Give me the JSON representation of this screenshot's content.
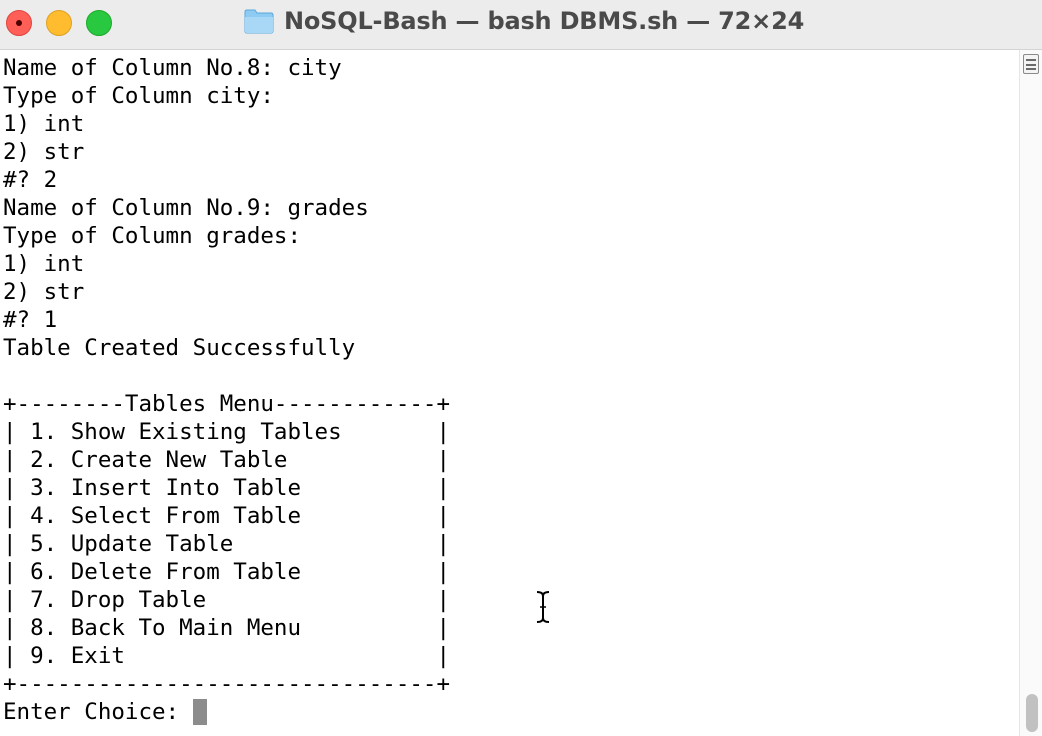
{
  "window": {
    "title": "NoSQL-Bash — bash DBMS.sh — 72×24"
  },
  "icons": {
    "folder": "folder-icon",
    "cursor": "ibeam-cursor-icon",
    "scroll_toggle": "split-pane-icon"
  },
  "colors": {
    "close": "#ff5f57",
    "minimize": "#febc2e",
    "maximize": "#28c840",
    "text": "#000000",
    "cursor": "#8c8c8c"
  },
  "terminal": {
    "lines": [
      "Name of Column No.8: city",
      "Type of Column city:",
      "1) int",
      "2) str",
      "#? 2",
      "Name of Column No.9: grades",
      "Type of Column grades:",
      "1) int",
      "2) str",
      "#? 1",
      "Table Created Successfully",
      "",
      "+--------Tables Menu------------+",
      "| 1. Show Existing Tables       |",
      "| 2. Create New Table           |",
      "| 3. Insert Into Table          |",
      "| 4. Select From Table          |",
      "| 5. Update Table               |",
      "| 6. Delete From Table          |",
      "| 7. Drop Table                 |",
      "| 8. Back To Main Menu          |",
      "| 9. Exit                       |",
      "+-------------------------------+"
    ],
    "prompt": "Enter Choice: "
  }
}
